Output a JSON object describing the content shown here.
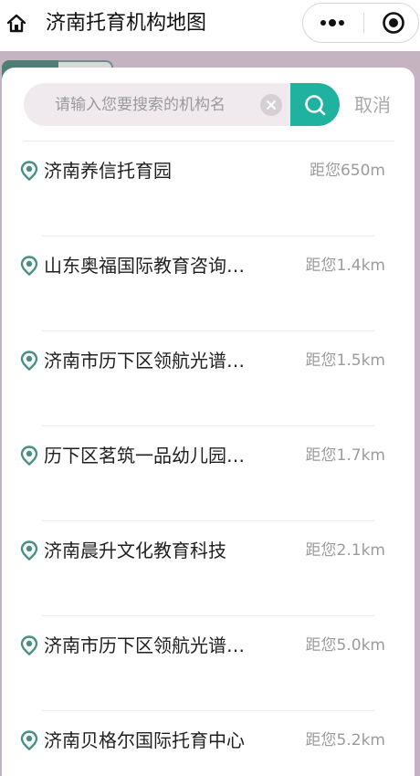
{
  "header": {
    "title": "济南托育机构地图",
    "home_icon": "home-icon",
    "more_icon": "more-dots-icon",
    "close_icon": "target-close-icon"
  },
  "search": {
    "placeholder": "请输入您要搜索的机构名",
    "value": "",
    "clear_icon": "clear-icon",
    "search_icon": "search-icon",
    "cancel_label": "取消",
    "accent_color": "#1fb39f"
  },
  "results": [
    {
      "name": "济南养信托育园",
      "distance": "距您650m"
    },
    {
      "name": "山东奥福国际教育咨询…",
      "distance": "距您1.4km"
    },
    {
      "name": "济南市历下区领航光谱…",
      "distance": "距您1.5km"
    },
    {
      "name": "历下区茗筑一品幼儿园…",
      "distance": "距您1.7km"
    },
    {
      "name": "济南晨升文化教育科技",
      "distance": "距您2.1km"
    },
    {
      "name": "济南市历下区领航光谱…",
      "distance": "距您5.0km"
    },
    {
      "name": "济南贝格尔国际托育中心",
      "distance": "距您5.2km"
    }
  ],
  "colors": {
    "map_background": "#c6b3c2",
    "pin_color": "#4a8f86"
  }
}
